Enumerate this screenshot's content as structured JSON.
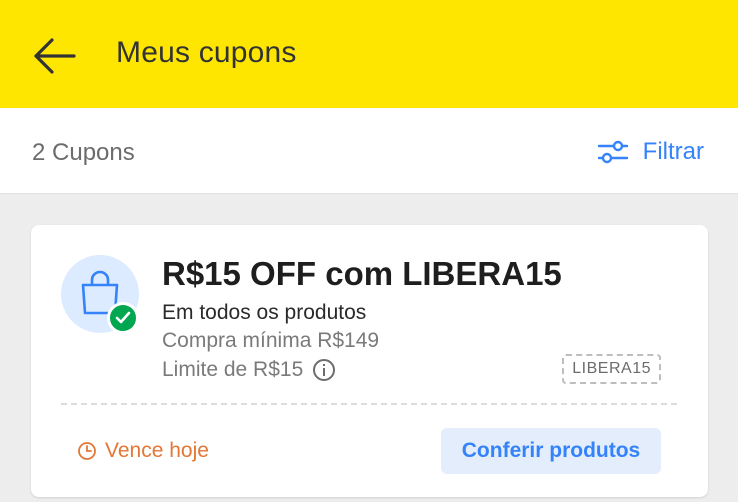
{
  "header": {
    "title": "Meus cupons"
  },
  "toolbar": {
    "count_label": "2 Cupons",
    "filter_label": "Filtrar"
  },
  "coupon": {
    "title": "R$15 OFF com LIBERA15",
    "scope": "Em todos os produtos",
    "minimum": "Compra mínima R$149",
    "limit": "Limite de R$15",
    "code": "LIBERA15",
    "expiry": "Vence hoje",
    "action_label": "Conferir produtos"
  },
  "icons": {
    "back": "arrow-left-icon",
    "filter": "sliders-icon",
    "coupon": "shopping-bag-icon",
    "status": "check-circle-icon",
    "info": "info-icon",
    "expiry": "clock-icon"
  },
  "colors": {
    "appbar": "#ffe600",
    "accent": "#3483fa",
    "success": "#00a650",
    "warning": "#e47735"
  }
}
